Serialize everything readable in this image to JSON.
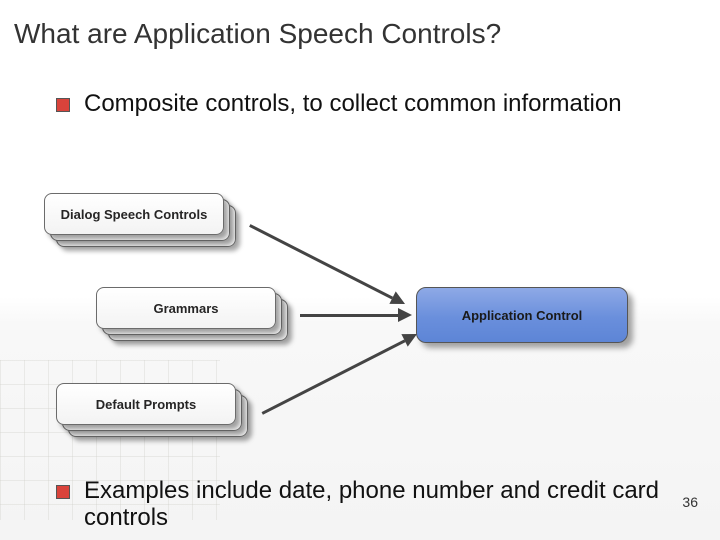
{
  "title": "What are Application Speech Controls?",
  "bullets": {
    "first": "Composite controls, to collect common information",
    "last": "Examples include date, phone number and credit card controls"
  },
  "diagram": {
    "dialog_label": "Dialog Speech Controls",
    "grammars_label": "Grammars",
    "prompts_label": "Default Prompts",
    "app_control_label": "Application Control"
  },
  "page_number": "36",
  "colors": {
    "bullet": "#d9433b",
    "app_control_bg": "#6a8fdc"
  }
}
